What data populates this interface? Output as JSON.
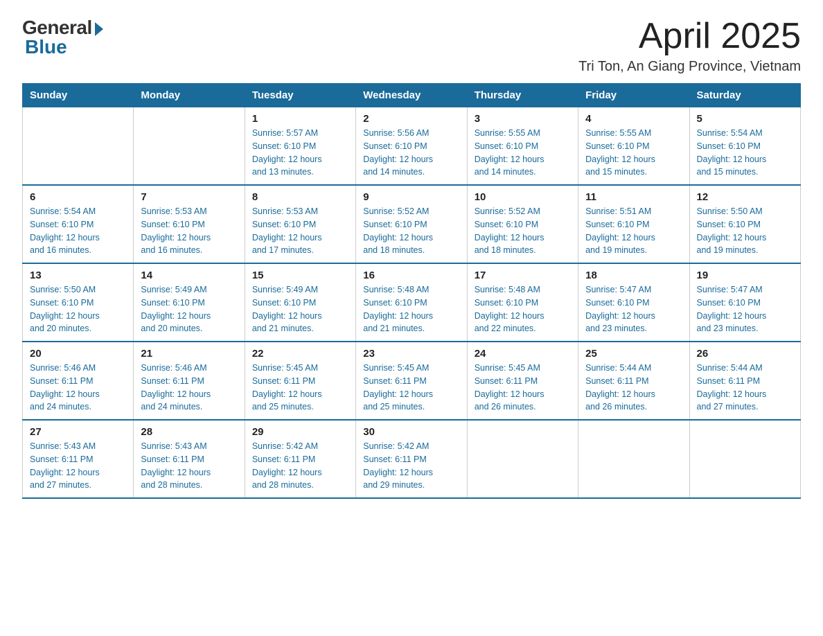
{
  "header": {
    "logo": {
      "general": "General",
      "blue": "Blue"
    },
    "title": "April 2025",
    "subtitle": "Tri Ton, An Giang Province, Vietnam"
  },
  "calendar": {
    "headers": [
      "Sunday",
      "Monday",
      "Tuesday",
      "Wednesday",
      "Thursday",
      "Friday",
      "Saturday"
    ],
    "weeks": [
      [
        {
          "day": "",
          "info": ""
        },
        {
          "day": "",
          "info": ""
        },
        {
          "day": "1",
          "info": "Sunrise: 5:57 AM\nSunset: 6:10 PM\nDaylight: 12 hours\nand 13 minutes."
        },
        {
          "day": "2",
          "info": "Sunrise: 5:56 AM\nSunset: 6:10 PM\nDaylight: 12 hours\nand 14 minutes."
        },
        {
          "day": "3",
          "info": "Sunrise: 5:55 AM\nSunset: 6:10 PM\nDaylight: 12 hours\nand 14 minutes."
        },
        {
          "day": "4",
          "info": "Sunrise: 5:55 AM\nSunset: 6:10 PM\nDaylight: 12 hours\nand 15 minutes."
        },
        {
          "day": "5",
          "info": "Sunrise: 5:54 AM\nSunset: 6:10 PM\nDaylight: 12 hours\nand 15 minutes."
        }
      ],
      [
        {
          "day": "6",
          "info": "Sunrise: 5:54 AM\nSunset: 6:10 PM\nDaylight: 12 hours\nand 16 minutes."
        },
        {
          "day": "7",
          "info": "Sunrise: 5:53 AM\nSunset: 6:10 PM\nDaylight: 12 hours\nand 16 minutes."
        },
        {
          "day": "8",
          "info": "Sunrise: 5:53 AM\nSunset: 6:10 PM\nDaylight: 12 hours\nand 17 minutes."
        },
        {
          "day": "9",
          "info": "Sunrise: 5:52 AM\nSunset: 6:10 PM\nDaylight: 12 hours\nand 18 minutes."
        },
        {
          "day": "10",
          "info": "Sunrise: 5:52 AM\nSunset: 6:10 PM\nDaylight: 12 hours\nand 18 minutes."
        },
        {
          "day": "11",
          "info": "Sunrise: 5:51 AM\nSunset: 6:10 PM\nDaylight: 12 hours\nand 19 minutes."
        },
        {
          "day": "12",
          "info": "Sunrise: 5:50 AM\nSunset: 6:10 PM\nDaylight: 12 hours\nand 19 minutes."
        }
      ],
      [
        {
          "day": "13",
          "info": "Sunrise: 5:50 AM\nSunset: 6:10 PM\nDaylight: 12 hours\nand 20 minutes."
        },
        {
          "day": "14",
          "info": "Sunrise: 5:49 AM\nSunset: 6:10 PM\nDaylight: 12 hours\nand 20 minutes."
        },
        {
          "day": "15",
          "info": "Sunrise: 5:49 AM\nSunset: 6:10 PM\nDaylight: 12 hours\nand 21 minutes."
        },
        {
          "day": "16",
          "info": "Sunrise: 5:48 AM\nSunset: 6:10 PM\nDaylight: 12 hours\nand 21 minutes."
        },
        {
          "day": "17",
          "info": "Sunrise: 5:48 AM\nSunset: 6:10 PM\nDaylight: 12 hours\nand 22 minutes."
        },
        {
          "day": "18",
          "info": "Sunrise: 5:47 AM\nSunset: 6:10 PM\nDaylight: 12 hours\nand 23 minutes."
        },
        {
          "day": "19",
          "info": "Sunrise: 5:47 AM\nSunset: 6:10 PM\nDaylight: 12 hours\nand 23 minutes."
        }
      ],
      [
        {
          "day": "20",
          "info": "Sunrise: 5:46 AM\nSunset: 6:11 PM\nDaylight: 12 hours\nand 24 minutes."
        },
        {
          "day": "21",
          "info": "Sunrise: 5:46 AM\nSunset: 6:11 PM\nDaylight: 12 hours\nand 24 minutes."
        },
        {
          "day": "22",
          "info": "Sunrise: 5:45 AM\nSunset: 6:11 PM\nDaylight: 12 hours\nand 25 minutes."
        },
        {
          "day": "23",
          "info": "Sunrise: 5:45 AM\nSunset: 6:11 PM\nDaylight: 12 hours\nand 25 minutes."
        },
        {
          "day": "24",
          "info": "Sunrise: 5:45 AM\nSunset: 6:11 PM\nDaylight: 12 hours\nand 26 minutes."
        },
        {
          "day": "25",
          "info": "Sunrise: 5:44 AM\nSunset: 6:11 PM\nDaylight: 12 hours\nand 26 minutes."
        },
        {
          "day": "26",
          "info": "Sunrise: 5:44 AM\nSunset: 6:11 PM\nDaylight: 12 hours\nand 27 minutes."
        }
      ],
      [
        {
          "day": "27",
          "info": "Sunrise: 5:43 AM\nSunset: 6:11 PM\nDaylight: 12 hours\nand 27 minutes."
        },
        {
          "day": "28",
          "info": "Sunrise: 5:43 AM\nSunset: 6:11 PM\nDaylight: 12 hours\nand 28 minutes."
        },
        {
          "day": "29",
          "info": "Sunrise: 5:42 AM\nSunset: 6:11 PM\nDaylight: 12 hours\nand 28 minutes."
        },
        {
          "day": "30",
          "info": "Sunrise: 5:42 AM\nSunset: 6:11 PM\nDaylight: 12 hours\nand 29 minutes."
        },
        {
          "day": "",
          "info": ""
        },
        {
          "day": "",
          "info": ""
        },
        {
          "day": "",
          "info": ""
        }
      ]
    ]
  }
}
